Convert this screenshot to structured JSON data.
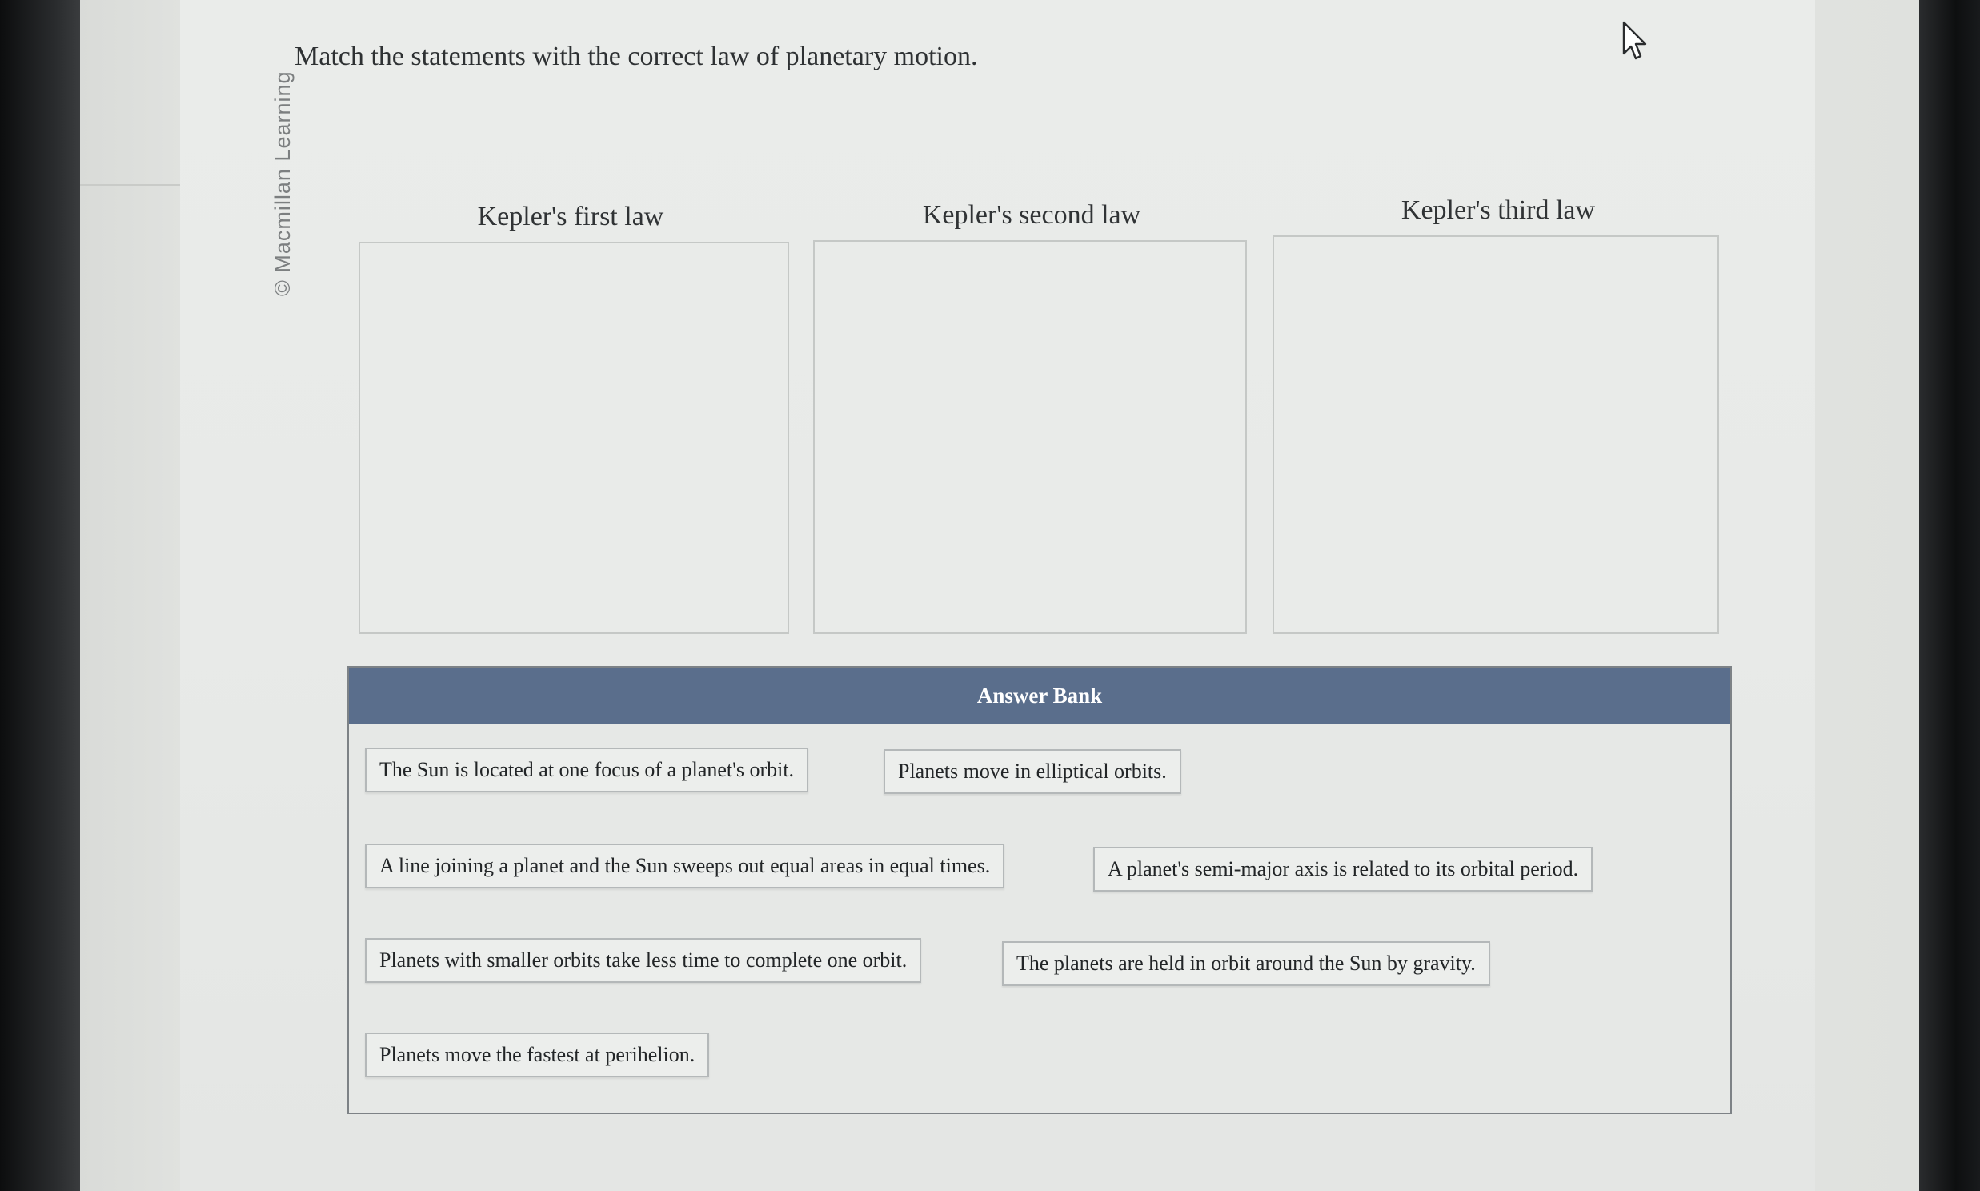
{
  "watermark": "© Macmillan Learning",
  "question": "Match the statements with the correct law of planetary motion.",
  "columns": [
    {
      "title": "Kepler's first law"
    },
    {
      "title": "Kepler's second law"
    },
    {
      "title": "Kepler's third law"
    }
  ],
  "answer_bank": {
    "title": "Answer Bank",
    "items": [
      "The Sun is located at one focus of a planet's orbit.",
      "Planets move in elliptical orbits.",
      "A line joining a planet and the Sun sweeps out equal areas in equal times.",
      "A planet's semi-major axis is related to its orbital period.",
      "Planets with smaller orbits take less time to complete one orbit.",
      "The planets are held in orbit around the Sun by gravity.",
      "Planets move the fastest at perihelion."
    ]
  },
  "icons": {
    "cursor": "mouse-pointer-icon"
  }
}
